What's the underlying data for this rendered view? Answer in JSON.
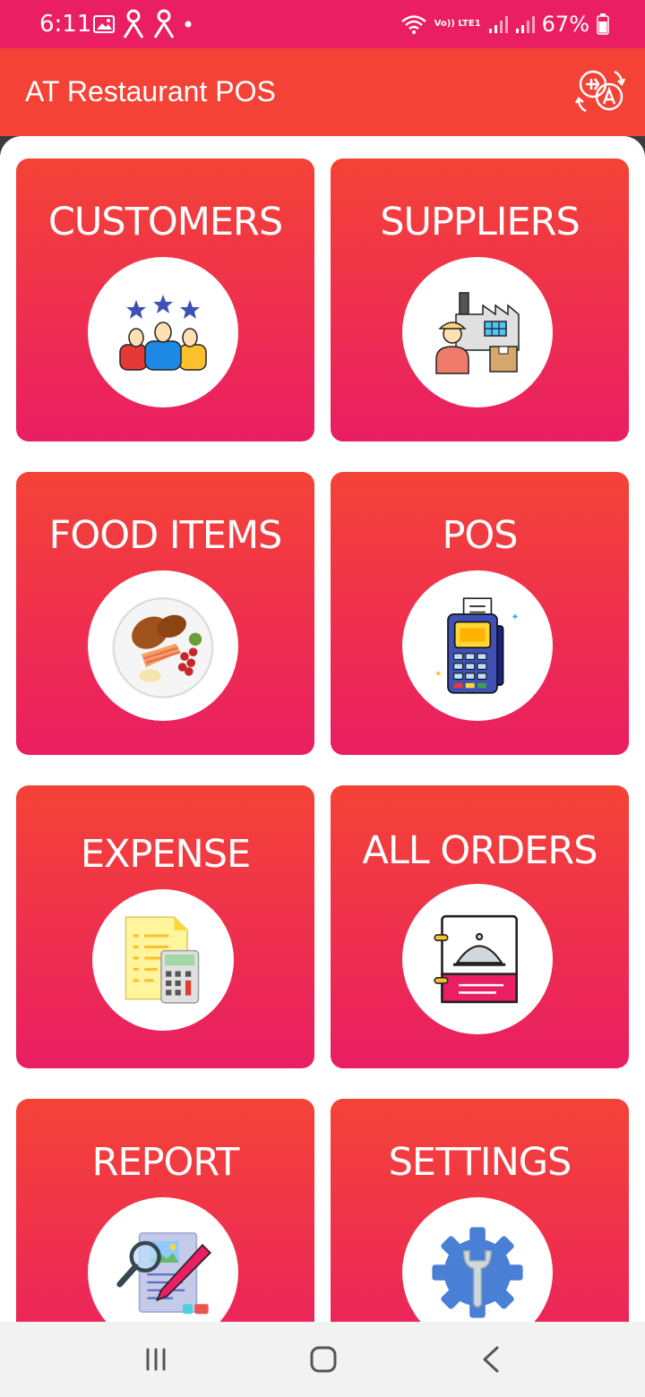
{
  "status_bar": {
    "time": "6:11",
    "battery": "67%",
    "network": "Vo)) LTE1"
  },
  "app_bar": {
    "title": "AT Restaurant POS"
  },
  "tiles": [
    {
      "label": "CUSTOMERS",
      "icon": "customers-icon"
    },
    {
      "label": "SUPPLIERS",
      "icon": "suppliers-icon"
    },
    {
      "label": "FOOD ITEMS",
      "icon": "food-items-icon"
    },
    {
      "label": "POS",
      "icon": "pos-terminal-icon"
    },
    {
      "label": "EXPENSE",
      "icon": "expense-icon"
    },
    {
      "label": "ALL ORDERS",
      "icon": "all-orders-icon"
    },
    {
      "label": "REPORT",
      "icon": "report-icon"
    },
    {
      "label": "SETTINGS",
      "icon": "settings-icon"
    }
  ],
  "colors": {
    "status_bar": "#e91e63",
    "app_bar": "#f44336",
    "tile_top": "#f44336",
    "tile_bottom": "#e91e63"
  },
  "nav_icons": [
    "recent-apps-icon",
    "home-icon",
    "back-icon"
  ]
}
